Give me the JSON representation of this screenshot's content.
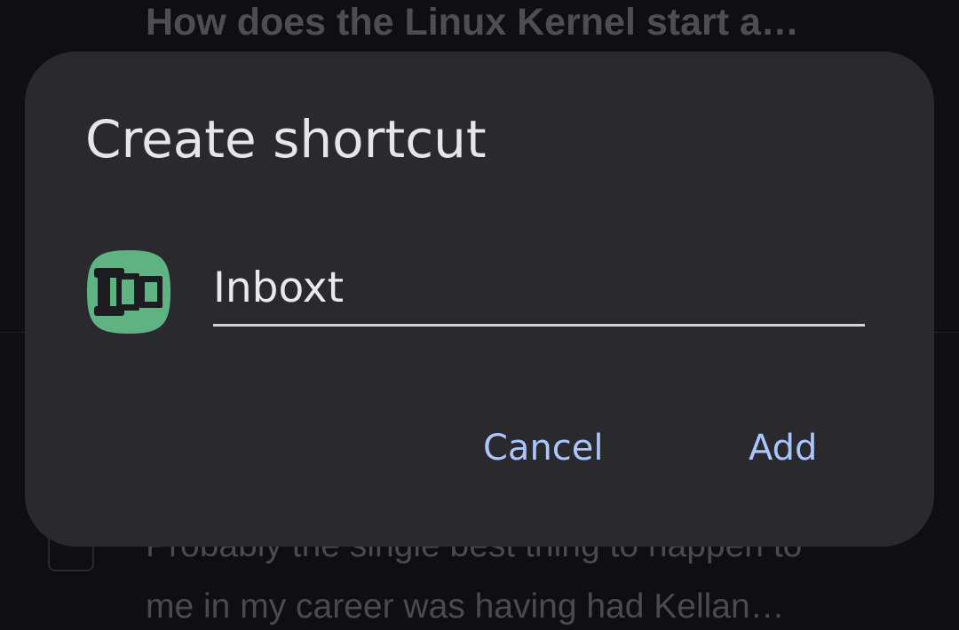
{
  "background": {
    "article_title": "How does the Linux Kernel start a…",
    "body_line_1": "Probably the single best thing to happen to",
    "body_line_2": "me in my career was having had Kellan…"
  },
  "dialog": {
    "title": "Create shortcut",
    "app_icon": "inboxt-app-icon",
    "name_field": {
      "value": "Inboxt",
      "placeholder": ""
    },
    "buttons": {
      "cancel_label": "Cancel",
      "add_label": "Add"
    }
  },
  "colors": {
    "dialog_background": "#29292e",
    "page_background": "#0f0f11",
    "accent": "#abc6fd",
    "icon_green": "#5fb282",
    "icon_dark": "#1c1c20",
    "text_primary": "#e6e5ea"
  }
}
